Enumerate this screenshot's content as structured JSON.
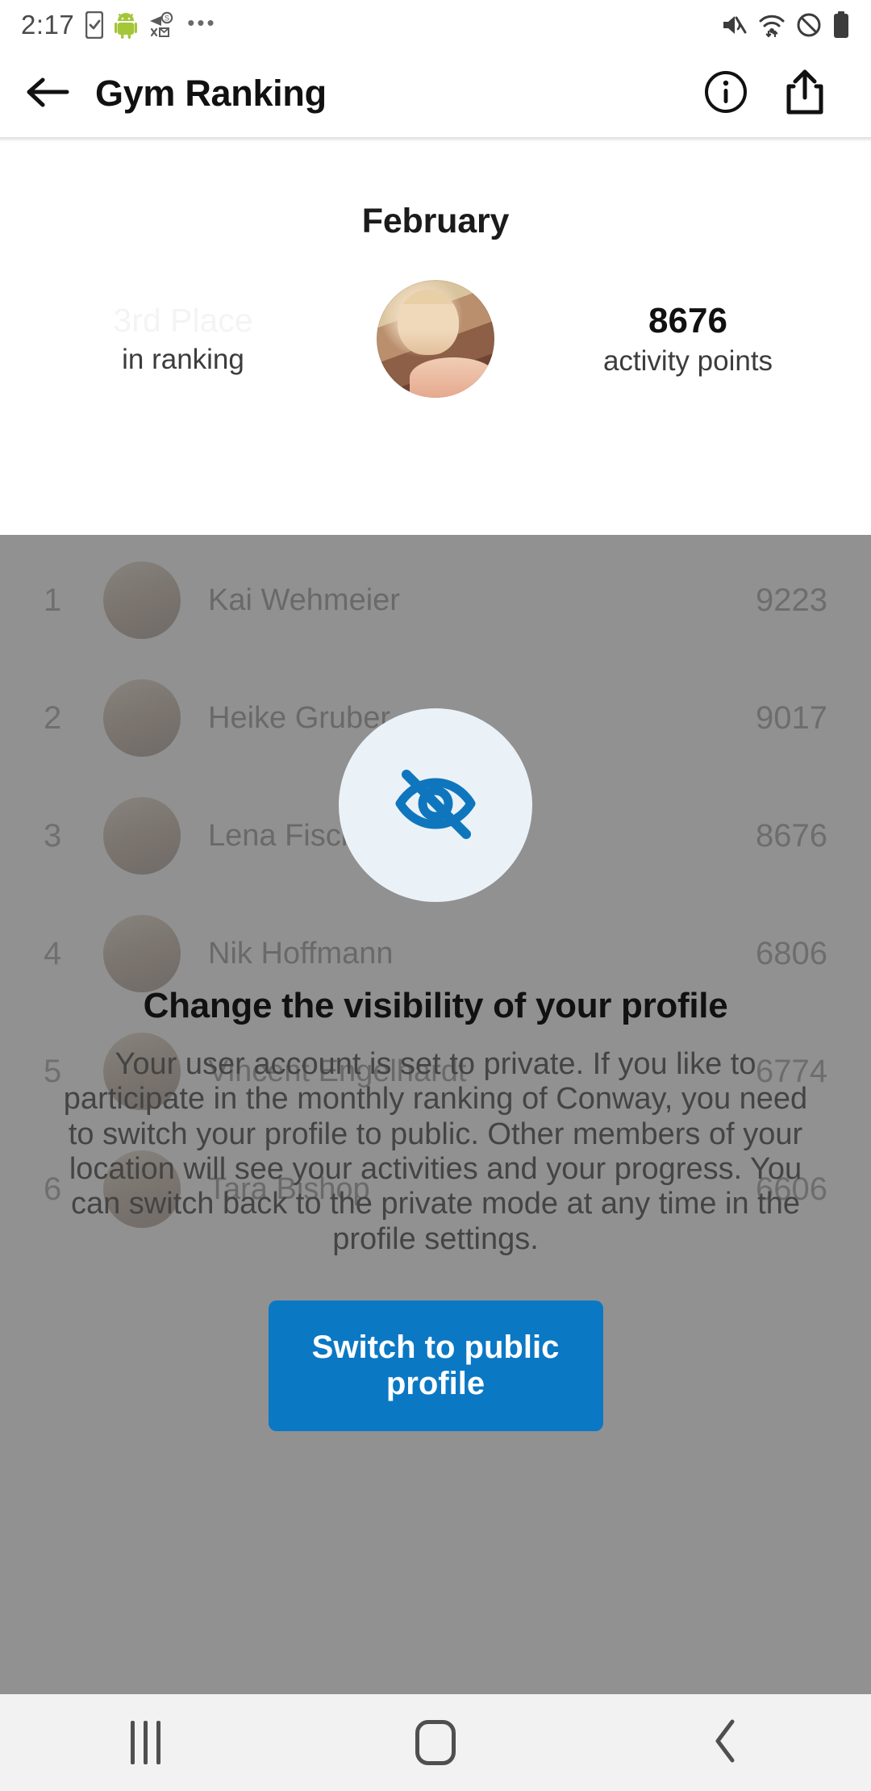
{
  "status_bar": {
    "time": "2:17",
    "left_icons": [
      "phone-check-icon",
      "android-robot-icon",
      "money-sms-icon",
      "more-dots-icon"
    ],
    "right_icons": [
      "mute-icon",
      "wifi-icon",
      "do-not-disturb-icon",
      "battery-icon"
    ]
  },
  "app_bar": {
    "back_icon": "arrow-left-icon",
    "title": "Gym Ranking",
    "info_icon": "info-circle-icon",
    "share_icon": "share-icon"
  },
  "header": {
    "month": "February",
    "place_value": "3rd Place",
    "place_label": "in ranking",
    "points_value": "8676",
    "points_label": "activity points",
    "avatar_name": "user-avatar"
  },
  "ranking": {
    "rows": [
      {
        "rank": "1",
        "name": "Kai Wehmeier",
        "points": "9223"
      },
      {
        "rank": "2",
        "name": "Heike Gruber",
        "points": "9017"
      },
      {
        "rank": "3",
        "name": "Lena Fischer",
        "points": "8676"
      },
      {
        "rank": "4",
        "name": "Nik Hoffmann",
        "points": "6806"
      },
      {
        "rank": "5",
        "name": "Vincent Engelhardt",
        "points": "6774"
      },
      {
        "rank": "6",
        "name": "Tara Bishop",
        "points": "6606"
      }
    ]
  },
  "dialog": {
    "icon": "eye-off-icon",
    "title": "Change the visibility of your profile",
    "body": "Your user account is set to private. If you like to participate in the monthly ranking of Conway, you need to switch your profile to public. Other members of your location will see your activities and your progress. You can switch back to the private mode at any time in the profile settings.",
    "button_label": "Switch to public profile"
  },
  "nav_bar": {
    "recents_label": "recents-icon",
    "home_label": "home-icon",
    "back_label": "back-icon"
  },
  "colors": {
    "accent_blue": "#0b78c4",
    "icon_circle_bg": "#eaf2f8",
    "scrim": "rgba(117,117,117,0.80)",
    "nav_bg": "#f2f2f2"
  }
}
